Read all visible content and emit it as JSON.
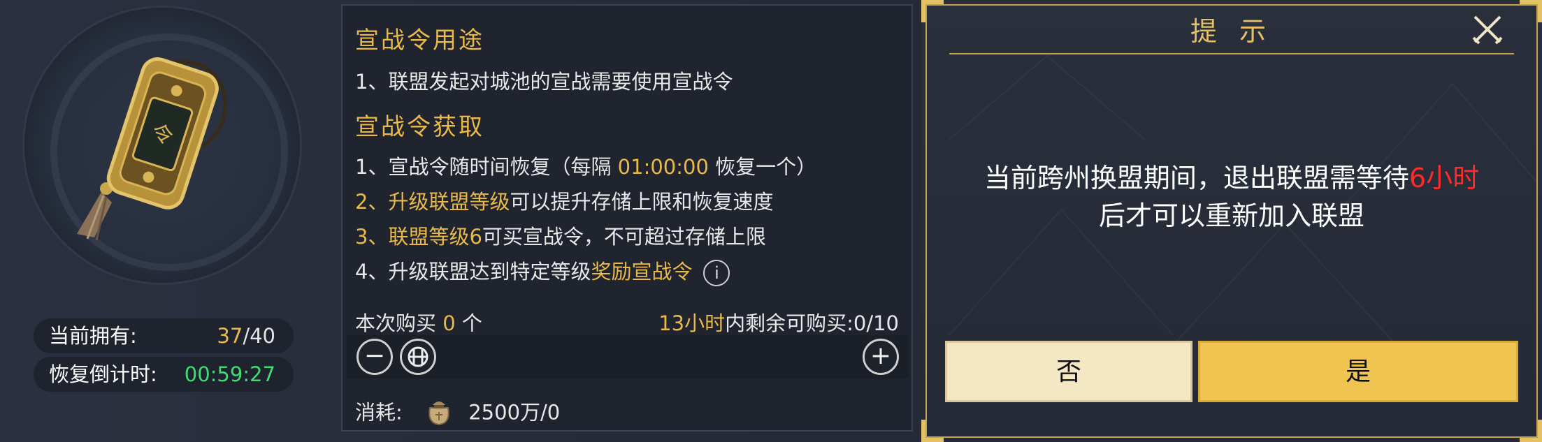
{
  "item": {
    "owned_label": "当前拥有:",
    "owned_current": "37",
    "owned_max": "/40",
    "timer_label": "恢复倒计时:",
    "timer_value": "00:59:27"
  },
  "info": {
    "usage_title": "宣战令用途",
    "usage_line1": "1、联盟发起对城池的宣战需要使用宣战令",
    "obtain_title": "宣战令获取",
    "obtain_line1_a": "1、宣战令随时间恢复（每隔 ",
    "obtain_line1_time": "01:00:00",
    "obtain_line1_b": " 恢复一个）",
    "obtain_line2_num": "2、",
    "obtain_line2_hl": "升级联盟等级",
    "obtain_line2_rest": "可以提升存储上限和恢复速度",
    "obtain_line3_num": "3、",
    "obtain_line3_hl": "联盟等级6",
    "obtain_line3_rest": "可买宣战令，不可超过存储上限",
    "obtain_line4_a": "4、升级联盟达到特定等级",
    "obtain_line4_hl": "奖励宣战令",
    "info_icon_glyph": "i"
  },
  "purchase": {
    "this_buy_label": "本次购买",
    "this_buy_count": "0",
    "this_buy_unit": "个",
    "limit_hl": "13小时",
    "limit_label": "内剩余可购买:",
    "limit_value": "0/10",
    "minus_glyph": "−",
    "plus_glyph": "+",
    "cost_label": "消耗:",
    "cost_value": "2500万/0"
  },
  "dialog": {
    "title": "提 示",
    "message_a": "当前跨州换盟期间，退出联盟需等待",
    "message_hl": "6小时",
    "message_b": "后才可以重新加入联盟",
    "no_label": "否",
    "yes_label": "是"
  },
  "colors": {
    "gold": "#e9b94a",
    "green": "#3fdc73",
    "red": "#ff2a2a",
    "yes_button": "#f0c451",
    "no_button": "#f3e7c4"
  },
  "icons": [
    "token-item-icon",
    "info-icon",
    "minus-icon",
    "max-icon",
    "plus-icon",
    "money-bag-icon",
    "close-crossed-swords-icon"
  ]
}
